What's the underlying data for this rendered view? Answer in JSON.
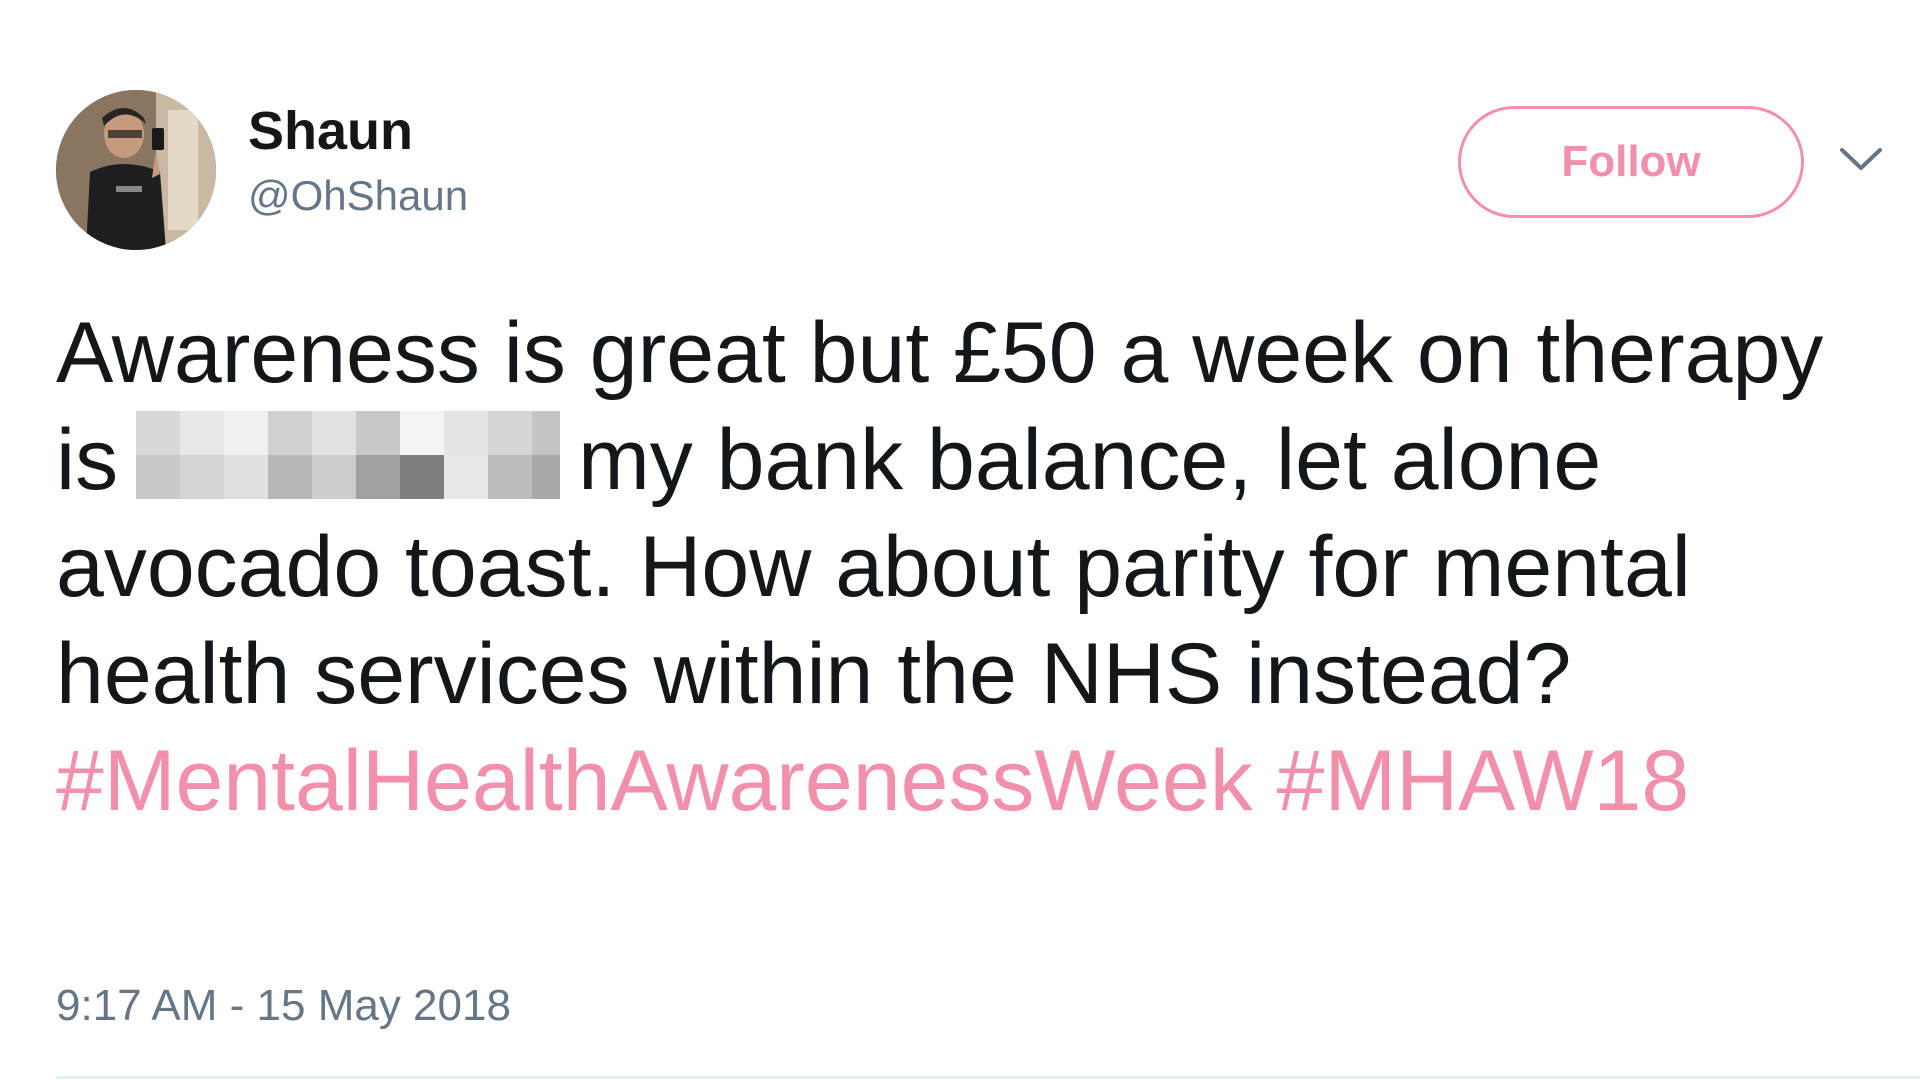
{
  "user": {
    "display_name": "Shaun",
    "handle": "@OhShaun",
    "avatar_icon": "profile-photo"
  },
  "actions": {
    "follow_label": "Follow",
    "menu_icon": "chevron-down-icon",
    "accent_color": "#f28fab"
  },
  "tweet": {
    "text_part1": "Awareness is great but £50 a week on therapy is",
    "censored_word_note": "",
    "text_part2": "my bank balance, let alone avocado toast. How about parity for mental health services within the NHS instead?",
    "hashtags": [
      "#MentalHealthAwarenessWeek",
      "#MHAW18"
    ],
    "timestamp": "9:17 AM - 15 May 2018"
  }
}
